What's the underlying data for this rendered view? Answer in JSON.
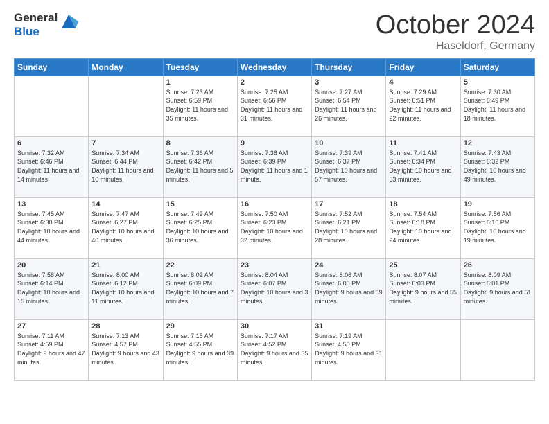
{
  "header": {
    "logo_general": "General",
    "logo_blue": "Blue",
    "month_title": "October 2024",
    "location": "Haseldorf, Germany"
  },
  "days_of_week": [
    "Sunday",
    "Monday",
    "Tuesday",
    "Wednesday",
    "Thursday",
    "Friday",
    "Saturday"
  ],
  "weeks": [
    [
      {
        "day": "",
        "sunrise": "",
        "sunset": "",
        "daylight": ""
      },
      {
        "day": "",
        "sunrise": "",
        "sunset": "",
        "daylight": ""
      },
      {
        "day": "1",
        "sunrise": "Sunrise: 7:23 AM",
        "sunset": "Sunset: 6:59 PM",
        "daylight": "Daylight: 11 hours and 35 minutes."
      },
      {
        "day": "2",
        "sunrise": "Sunrise: 7:25 AM",
        "sunset": "Sunset: 6:56 PM",
        "daylight": "Daylight: 11 hours and 31 minutes."
      },
      {
        "day": "3",
        "sunrise": "Sunrise: 7:27 AM",
        "sunset": "Sunset: 6:54 PM",
        "daylight": "Daylight: 11 hours and 26 minutes."
      },
      {
        "day": "4",
        "sunrise": "Sunrise: 7:29 AM",
        "sunset": "Sunset: 6:51 PM",
        "daylight": "Daylight: 11 hours and 22 minutes."
      },
      {
        "day": "5",
        "sunrise": "Sunrise: 7:30 AM",
        "sunset": "Sunset: 6:49 PM",
        "daylight": "Daylight: 11 hours and 18 minutes."
      }
    ],
    [
      {
        "day": "6",
        "sunrise": "Sunrise: 7:32 AM",
        "sunset": "Sunset: 6:46 PM",
        "daylight": "Daylight: 11 hours and 14 minutes."
      },
      {
        "day": "7",
        "sunrise": "Sunrise: 7:34 AM",
        "sunset": "Sunset: 6:44 PM",
        "daylight": "Daylight: 11 hours and 10 minutes."
      },
      {
        "day": "8",
        "sunrise": "Sunrise: 7:36 AM",
        "sunset": "Sunset: 6:42 PM",
        "daylight": "Daylight: 11 hours and 5 minutes."
      },
      {
        "day": "9",
        "sunrise": "Sunrise: 7:38 AM",
        "sunset": "Sunset: 6:39 PM",
        "daylight": "Daylight: 11 hours and 1 minute."
      },
      {
        "day": "10",
        "sunrise": "Sunrise: 7:39 AM",
        "sunset": "Sunset: 6:37 PM",
        "daylight": "Daylight: 10 hours and 57 minutes."
      },
      {
        "day": "11",
        "sunrise": "Sunrise: 7:41 AM",
        "sunset": "Sunset: 6:34 PM",
        "daylight": "Daylight: 10 hours and 53 minutes."
      },
      {
        "day": "12",
        "sunrise": "Sunrise: 7:43 AM",
        "sunset": "Sunset: 6:32 PM",
        "daylight": "Daylight: 10 hours and 49 minutes."
      }
    ],
    [
      {
        "day": "13",
        "sunrise": "Sunrise: 7:45 AM",
        "sunset": "Sunset: 6:30 PM",
        "daylight": "Daylight: 10 hours and 44 minutes."
      },
      {
        "day": "14",
        "sunrise": "Sunrise: 7:47 AM",
        "sunset": "Sunset: 6:27 PM",
        "daylight": "Daylight: 10 hours and 40 minutes."
      },
      {
        "day": "15",
        "sunrise": "Sunrise: 7:49 AM",
        "sunset": "Sunset: 6:25 PM",
        "daylight": "Daylight: 10 hours and 36 minutes."
      },
      {
        "day": "16",
        "sunrise": "Sunrise: 7:50 AM",
        "sunset": "Sunset: 6:23 PM",
        "daylight": "Daylight: 10 hours and 32 minutes."
      },
      {
        "day": "17",
        "sunrise": "Sunrise: 7:52 AM",
        "sunset": "Sunset: 6:21 PM",
        "daylight": "Daylight: 10 hours and 28 minutes."
      },
      {
        "day": "18",
        "sunrise": "Sunrise: 7:54 AM",
        "sunset": "Sunset: 6:18 PM",
        "daylight": "Daylight: 10 hours and 24 minutes."
      },
      {
        "day": "19",
        "sunrise": "Sunrise: 7:56 AM",
        "sunset": "Sunset: 6:16 PM",
        "daylight": "Daylight: 10 hours and 19 minutes."
      }
    ],
    [
      {
        "day": "20",
        "sunrise": "Sunrise: 7:58 AM",
        "sunset": "Sunset: 6:14 PM",
        "daylight": "Daylight: 10 hours and 15 minutes."
      },
      {
        "day": "21",
        "sunrise": "Sunrise: 8:00 AM",
        "sunset": "Sunset: 6:12 PM",
        "daylight": "Daylight: 10 hours and 11 minutes."
      },
      {
        "day": "22",
        "sunrise": "Sunrise: 8:02 AM",
        "sunset": "Sunset: 6:09 PM",
        "daylight": "Daylight: 10 hours and 7 minutes."
      },
      {
        "day": "23",
        "sunrise": "Sunrise: 8:04 AM",
        "sunset": "Sunset: 6:07 PM",
        "daylight": "Daylight: 10 hours and 3 minutes."
      },
      {
        "day": "24",
        "sunrise": "Sunrise: 8:06 AM",
        "sunset": "Sunset: 6:05 PM",
        "daylight": "Daylight: 9 hours and 59 minutes."
      },
      {
        "day": "25",
        "sunrise": "Sunrise: 8:07 AM",
        "sunset": "Sunset: 6:03 PM",
        "daylight": "Daylight: 9 hours and 55 minutes."
      },
      {
        "day": "26",
        "sunrise": "Sunrise: 8:09 AM",
        "sunset": "Sunset: 6:01 PM",
        "daylight": "Daylight: 9 hours and 51 minutes."
      }
    ],
    [
      {
        "day": "27",
        "sunrise": "Sunrise: 7:11 AM",
        "sunset": "Sunset: 4:59 PM",
        "daylight": "Daylight: 9 hours and 47 minutes."
      },
      {
        "day": "28",
        "sunrise": "Sunrise: 7:13 AM",
        "sunset": "Sunset: 4:57 PM",
        "daylight": "Daylight: 9 hours and 43 minutes."
      },
      {
        "day": "29",
        "sunrise": "Sunrise: 7:15 AM",
        "sunset": "Sunset: 4:55 PM",
        "daylight": "Daylight: 9 hours and 39 minutes."
      },
      {
        "day": "30",
        "sunrise": "Sunrise: 7:17 AM",
        "sunset": "Sunset: 4:52 PM",
        "daylight": "Daylight: 9 hours and 35 minutes."
      },
      {
        "day": "31",
        "sunrise": "Sunrise: 7:19 AM",
        "sunset": "Sunset: 4:50 PM",
        "daylight": "Daylight: 9 hours and 31 minutes."
      },
      {
        "day": "",
        "sunrise": "",
        "sunset": "",
        "daylight": ""
      },
      {
        "day": "",
        "sunrise": "",
        "sunset": "",
        "daylight": ""
      }
    ]
  ]
}
